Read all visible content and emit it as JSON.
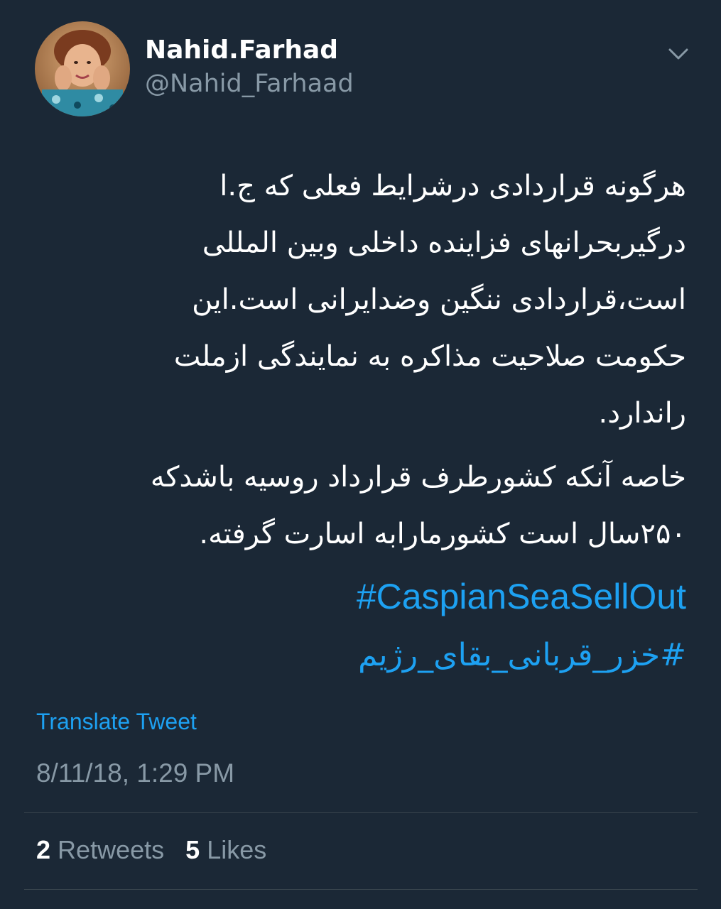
{
  "author": {
    "display_name": "Nahid.Farhad",
    "handle": "@Nahid_Farhaad",
    "avatar_icon": "profile-photo"
  },
  "menu": {
    "icon": "chevron-down-icon"
  },
  "tweet": {
    "paragraph_1": [
      "هرگونه قراردادی درشرایط فعلی که ج.ا",
      "درگیربحرانهای فزاینده داخلی وبین المللی",
      "است،قراردادی ننگین وضدایرانی است.این",
      "حکومت صلاحیت مذاکره به نمایندگی ازملت",
      "راندارد."
    ],
    "paragraph_2": [
      "خاصه آنکه کشورطرف قرارداد روسیه باشدکه",
      "۲۵۰سال است کشورمارابه اسارت گرفته."
    ],
    "hashtag_1": "#CaspianSeaSellOut",
    "hashtag_2": "#خزر_قربانی_بقای_رژیم"
  },
  "translate_label": "Translate Tweet",
  "timestamp": "8/11/18, 1:29 PM",
  "stats": {
    "retweets_count": "2",
    "retweets_label": "Retweets",
    "likes_count": "5",
    "likes_label": "Likes"
  },
  "colors": {
    "background": "#1b2836",
    "link": "#1da1f2",
    "secondary_text": "#8899a6",
    "divider": "#38444d"
  }
}
